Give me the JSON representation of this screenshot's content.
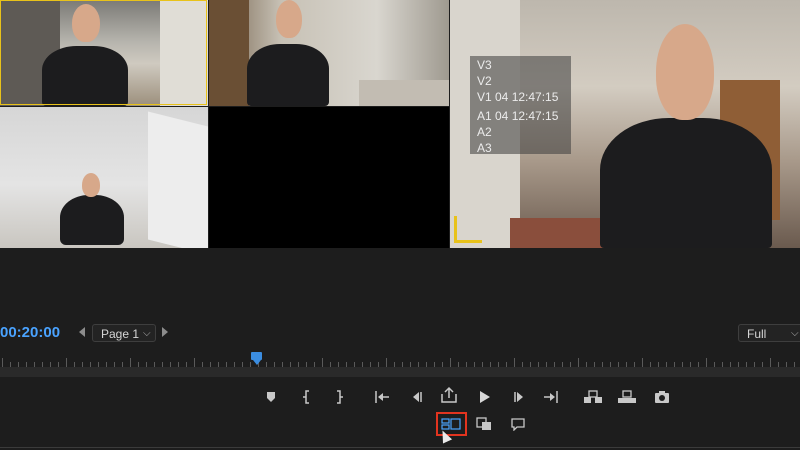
{
  "multicam": {
    "cameras": [
      "camera-1",
      "camera-2",
      "camera-3",
      "camera-4"
    ],
    "selected_camera": 1,
    "selected_color": "#e8c21a"
  },
  "program_overlay": {
    "lines": [
      "V3",
      "V2",
      "V1 04 12:47:15",
      "A1 04 12:47:15",
      "A2",
      "A3"
    ]
  },
  "timecode": "00:20:00",
  "page_select": {
    "value": "Page 1"
  },
  "resolution_select": {
    "value": "Full"
  },
  "playhead_color": "#3b8de0",
  "accent_timecode_color": "#4aa3ff",
  "highlight_color": "#e2341f",
  "transport_buttons": [
    "add-marker",
    "mark-in",
    "mark-out",
    "go-to-in",
    "step-back",
    "export-frame-lift",
    "play",
    "step-forward",
    "go-to-out",
    "insert",
    "overwrite",
    "export-frame"
  ],
  "secondary_buttons": [
    "toggle-multicam-view",
    "comparison-view",
    "captions"
  ]
}
